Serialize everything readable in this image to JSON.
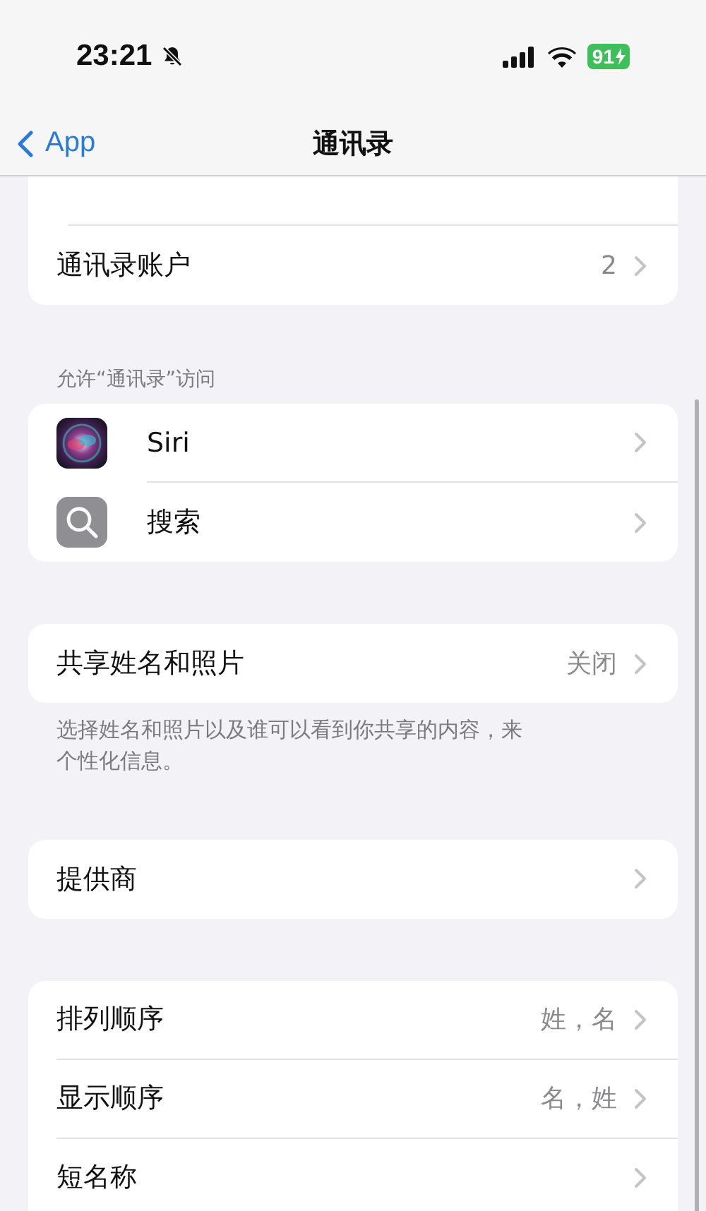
{
  "status_bar": {
    "time": "23:21",
    "battery": "91"
  },
  "nav": {
    "back": "App",
    "title": "通讯录"
  },
  "groups": [
    {
      "cut_top": true,
      "rows": [
        {
          "kind": "plain",
          "label": "通讯录账户",
          "value": "2"
        }
      ]
    },
    {
      "header": "允许“通讯录”访问",
      "rows": [
        {
          "kind": "siri",
          "label": "Siri"
        },
        {
          "kind": "search",
          "label": "搜索"
        }
      ]
    },
    {
      "rows": [
        {
          "kind": "plain",
          "label": "共享姓名和照片",
          "value": "关闭"
        }
      ],
      "footer": "选择姓名和照片以及谁可以看到你共享的内容，来个性化信息。"
    },
    {
      "rows": [
        {
          "kind": "plain",
          "label": "提供商"
        }
      ]
    },
    {
      "cut_bottom": true,
      "rows": [
        {
          "kind": "plain",
          "label": "排列顺序",
          "value": "姓，名"
        },
        {
          "kind": "plain",
          "label": "显示顺序",
          "value": "名，姓"
        },
        {
          "kind": "plain",
          "label": "短名称"
        }
      ]
    }
  ]
}
